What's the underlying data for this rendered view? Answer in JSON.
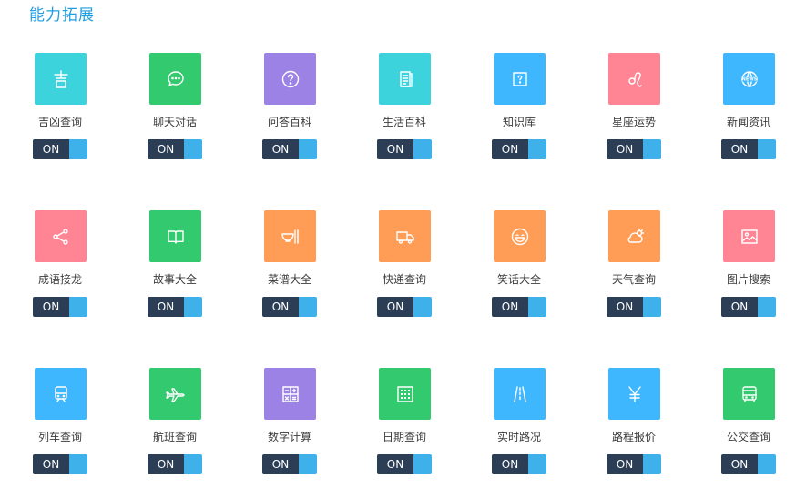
{
  "page": {
    "title": "能力拓展"
  },
  "toggle_label": "ON",
  "colors": {
    "title": "#1e9ee0",
    "toggle_dark": "#2c3e56",
    "toggle_knob": "#3fb1ea",
    "teal": "#3dd3dd",
    "green": "#33c96e",
    "purple": "#9d82e6",
    "blue": "#3fb7ff",
    "pink": "#ff8595",
    "orange": "#ff9d56"
  },
  "skills": [
    {
      "label": "吉凶查询",
      "color": "#3dd3dd",
      "icon": "ji-character-icon",
      "enabled": "ON"
    },
    {
      "label": "聊天对话",
      "color": "#33c96e",
      "icon": "chat-bubble-icon",
      "enabled": "ON"
    },
    {
      "label": "问答百科",
      "color": "#9d82e6",
      "icon": "question-icon",
      "enabled": "ON"
    },
    {
      "label": "生活百科",
      "color": "#3dd3dd",
      "icon": "document-icon",
      "enabled": "ON"
    },
    {
      "label": "知识库",
      "color": "#3fb7ff",
      "icon": "question-box-icon",
      "enabled": "ON"
    },
    {
      "label": "星座运势",
      "color": "#ff8595",
      "icon": "leo-sign-icon",
      "enabled": "ON"
    },
    {
      "label": "新闻资讯",
      "color": "#3fb7ff",
      "icon": "news-globe-icon",
      "enabled": "ON"
    },
    {
      "label": "成语接龙",
      "color": "#ff8595",
      "icon": "share-icon",
      "enabled": "ON"
    },
    {
      "label": "故事大全",
      "color": "#33c96e",
      "icon": "book-icon",
      "enabled": "ON"
    },
    {
      "label": "菜谱大全",
      "color": "#ff9d56",
      "icon": "bowl-chopsticks-icon",
      "enabled": "ON"
    },
    {
      "label": "快递查询",
      "color": "#ff9d56",
      "icon": "truck-icon",
      "enabled": "ON"
    },
    {
      "label": "笑话大全",
      "color": "#ff9d56",
      "icon": "smile-icon",
      "enabled": "ON"
    },
    {
      "label": "天气查询",
      "color": "#ff9d56",
      "icon": "weather-icon",
      "enabled": "ON"
    },
    {
      "label": "图片搜索",
      "color": "#ff8595",
      "icon": "image-icon",
      "enabled": "ON"
    },
    {
      "label": "列车查询",
      "color": "#3fb7ff",
      "icon": "train-icon",
      "enabled": "ON"
    },
    {
      "label": "航班查询",
      "color": "#33c96e",
      "icon": "airplane-icon",
      "enabled": "ON"
    },
    {
      "label": "数字计算",
      "color": "#9d82e6",
      "icon": "calculator-icon",
      "enabled": "ON"
    },
    {
      "label": "日期查询",
      "color": "#33c96e",
      "icon": "calendar-icon",
      "enabled": "ON"
    },
    {
      "label": "实时路况",
      "color": "#3fb7ff",
      "icon": "road-icon",
      "enabled": "ON"
    },
    {
      "label": "路程报价",
      "color": "#3fb7ff",
      "icon": "yen-icon",
      "enabled": "ON"
    },
    {
      "label": "公交查询",
      "color": "#33c96e",
      "icon": "bus-icon",
      "enabled": "ON"
    }
  ]
}
